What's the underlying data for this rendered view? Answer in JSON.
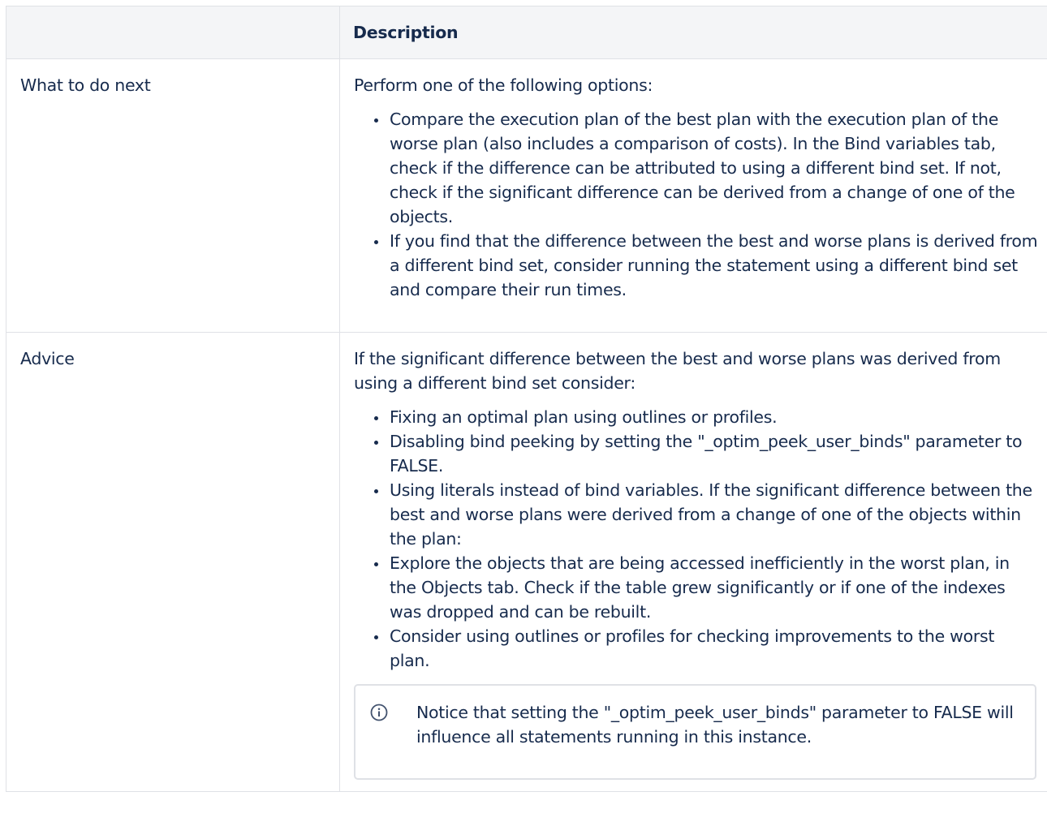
{
  "table": {
    "header": {
      "col1": "",
      "col2": "Description"
    },
    "rows": [
      {
        "label": "What to do next",
        "intro": "Perform one of the following options:",
        "items": [
          "Compare the execution plan of the best plan with the execution plan of the worse plan (also includes a comparison of costs). In the Bind variables tab, check if the difference can be attributed to using a different bind set. If not, check if the significant difference can be derived from a change of one of the objects.",
          "If you find that the difference between the best and worse plans is derived from a different bind set, consider running the statement using a different bind set and compare their run times."
        ]
      },
      {
        "label": "Advice",
        "intro": "If the significant difference between the best and worse plans was derived from using a different bind set consider:",
        "items": [
          "Fixing an optimal plan using outlines or profiles.",
          "Disabling bind peeking by setting the \"_optim_peek_user_binds\" parameter to FALSE.",
          "Using literals instead of bind variables. If the significant difference between the best and worse plans were derived from a change of one of the objects within the plan:",
          "Explore the objects that are being accessed inefficiently in the worst plan, in the Objects tab. Check if the table grew significantly or if one of the indexes was dropped and can be rebuilt.",
          "Consider using outlines or profiles for checking improvements to the worst plan."
        ],
        "note": {
          "icon": "info-icon",
          "text": "Notice that setting the \"_optim_peek_user_binds\" parameter to FALSE will influence all statements running in this instance."
        }
      }
    ]
  },
  "colors": {
    "text": "#172b4d",
    "border": "#dfe1e6",
    "header_bg": "#f4f5f7"
  }
}
